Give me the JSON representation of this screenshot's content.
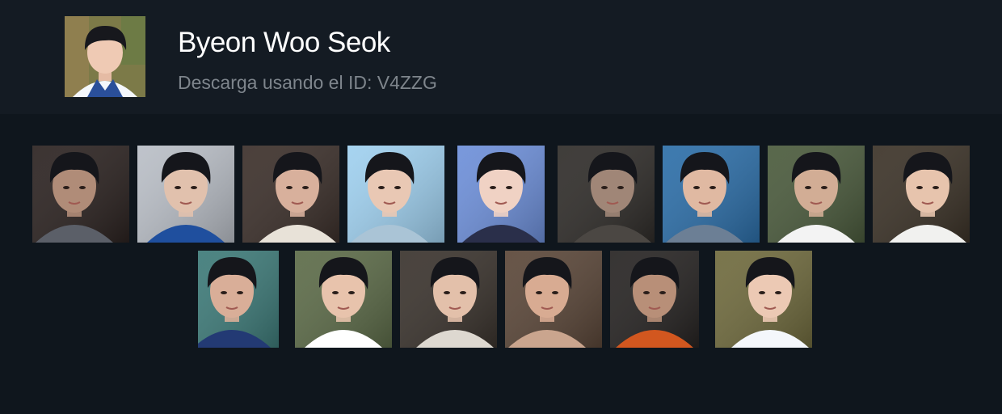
{
  "profile": {
    "name": "Byeon Woo Seok",
    "subtitle": "Descarga usando el ID: V4ZZG",
    "avatar": "portrait-photo"
  },
  "stickers_row1": [
    {
      "id": "sticker-1",
      "bg": "#2b2220",
      "skin": "#b08c78",
      "shirt": "#5b5f68"
    },
    {
      "id": "sticker-2",
      "bg": "#b9bec6",
      "skin": "#e1c1ad",
      "shirt": "#1f4f9e"
    },
    {
      "id": "sticker-3",
      "bg": "#3b2f2a",
      "skin": "#d8b09c",
      "shirt": "#e8e2d8"
    },
    {
      "id": "sticker-4",
      "bg": "#9fd0ef",
      "skin": "#e9c8b4",
      "shirt": "#aac4d6"
    },
    {
      "id": "sticker-5",
      "bg": "#6d8fd9",
      "skin": "#f0d2c4",
      "shirt": "#2a2f4a"
    },
    {
      "id": "sticker-6",
      "bg": "#2f2c29",
      "skin": "#a08677",
      "shirt": "#4b4743"
    },
    {
      "id": "sticker-7",
      "bg": "#2c6ea8",
      "skin": "#e0b9a2",
      "shirt": "#6c7f95"
    },
    {
      "id": "sticker-8",
      "bg": "#4a5a3c",
      "skin": "#d2ad95",
      "shirt": "#f3f3f3"
    },
    {
      "id": "sticker-9",
      "bg": "#3b3227",
      "skin": "#e7c4ad",
      "shirt": "#f1f1ef"
    }
  ],
  "stickers_row2": [
    {
      "id": "sticker-10",
      "bg": "#3d7a78",
      "skin": "#d9ae98",
      "shirt": "#233a74"
    },
    {
      "id": "sticker-11",
      "bg": "#5c6b48",
      "skin": "#e8c3ac",
      "shirt": "#ffffff"
    },
    {
      "id": "sticker-12",
      "bg": "#3a332d",
      "skin": "#e3c0aa",
      "shirt": "#ddd8d0"
    },
    {
      "id": "sticker-13",
      "bg": "#5a4638",
      "skin": "#d8ab92",
      "shirt": "#caa58e"
    },
    {
      "id": "sticker-14",
      "bg": "#262322",
      "skin": "#b88f78",
      "shirt": "#d2571f"
    },
    {
      "id": "sticker-15",
      "bg": "#6f6a3d",
      "skin": "#ecc9b4",
      "shirt": "#f4f7fb"
    }
  ]
}
